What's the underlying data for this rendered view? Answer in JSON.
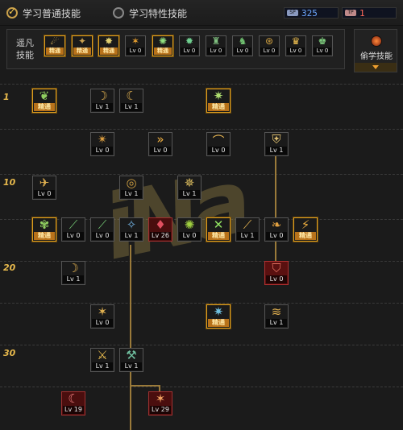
{
  "tabs": {
    "normal": "学习普通技能",
    "special": "学习特性技能"
  },
  "sp": {
    "sp_tag": "SP",
    "sp_value": "325",
    "tp_tag": "TP",
    "tp_value": "1"
  },
  "quickbar": {
    "label_line1": "遥凡",
    "label_line2": "技能"
  },
  "steal": {
    "label": "偷学技能"
  },
  "levels": [
    "1",
    "10",
    "20",
    "30"
  ],
  "colors": {
    "gold": "#e0a020",
    "accent": "#f5c84c",
    "line": "#9a7a3a"
  },
  "watermark": "iNa",
  "icons": {
    "quickbar": [
      {
        "badge": "精通",
        "mastered": true,
        "glyph": "☄",
        "color": "#e8c060"
      },
      {
        "badge": "精通",
        "mastered": true,
        "glyph": "✦",
        "color": "#c8a050"
      },
      {
        "badge": "精通",
        "mastered": true,
        "glyph": "✸",
        "color": "#e0d070"
      },
      {
        "badge": "Lv 0",
        "mastered": false,
        "glyph": "✶",
        "color": "#e8a030"
      },
      {
        "badge": "精通",
        "mastered": true,
        "glyph": "✺",
        "color": "#90e080"
      },
      {
        "badge": "Lv 0",
        "mastered": false,
        "glyph": "✹",
        "color": "#70d090"
      },
      {
        "badge": "Lv 0",
        "mastered": false,
        "glyph": "♜",
        "color": "#80c080"
      },
      {
        "badge": "Lv 0",
        "mastered": false,
        "glyph": "♞",
        "color": "#70c070"
      },
      {
        "badge": "Lv 0",
        "mastered": false,
        "glyph": "⊛",
        "color": "#d0a040"
      },
      {
        "badge": "Lv 0",
        "mastered": false,
        "glyph": "♛",
        "color": "#f0c050"
      },
      {
        "badge": "Lv 0",
        "mastered": false,
        "glyph": "♚",
        "color": "#80d080"
      }
    ],
    "tree": [
      {
        "badge": "精通",
        "mastered": true,
        "glyph": "❦",
        "color": "#90d060"
      },
      {
        "badge": "Lv 1",
        "mastered": false,
        "glyph": "☽",
        "color": "#e0b050"
      },
      {
        "badge": "Lv 1",
        "mastered": false,
        "glyph": "☾",
        "color": "#e0b050"
      },
      {
        "badge": "精通",
        "mastered": true,
        "glyph": "✷",
        "color": "#b0e070"
      },
      {
        "badge": "Lv 0",
        "mastered": false,
        "glyph": "✴",
        "color": "#e0a040"
      },
      {
        "badge": "Lv 0",
        "mastered": false,
        "glyph": "»",
        "color": "#f0b040"
      },
      {
        "badge": "Lv 0",
        "mastered": false,
        "glyph": "⌒",
        "color": "#e0b050"
      },
      {
        "badge": "Lv 1",
        "mastered": false,
        "glyph": "⛨",
        "color": "#e0c070"
      },
      {
        "badge": "Lv 0",
        "mastered": false,
        "glyph": "✈",
        "color": "#e0b050"
      },
      {
        "badge": "Lv 1",
        "mastered": false,
        "glyph": "◎",
        "color": "#d0a040"
      },
      {
        "badge": "Lv 1",
        "mastered": false,
        "glyph": "✵",
        "color": "#e0c060"
      },
      {
        "badge": "精通",
        "mastered": true,
        "glyph": "✾",
        "color": "#90d060"
      },
      {
        "badge": "Lv 0",
        "mastered": false,
        "glyph": "⟋",
        "color": "#70c070"
      },
      {
        "badge": "Lv 0",
        "mastered": false,
        "glyph": "⟋",
        "color": "#70c070"
      },
      {
        "badge": "Lv 1",
        "mastered": false,
        "glyph": "✧",
        "color": "#70b0e0"
      },
      {
        "badge": "Lv 26",
        "mastered": false,
        "glyph": "♦",
        "color": "#e05060"
      },
      {
        "badge": "Lv 0",
        "mastered": false,
        "glyph": "✺",
        "color": "#a0d040"
      },
      {
        "badge": "精通",
        "mastered": true,
        "glyph": "✕",
        "color": "#90e060"
      },
      {
        "badge": "Lv 1",
        "mastered": false,
        "glyph": "⟋",
        "color": "#e0b050"
      },
      {
        "badge": "Lv 0",
        "mastered": false,
        "glyph": "❧",
        "color": "#e0a040"
      },
      {
        "badge": "精通",
        "mastered": true,
        "glyph": "⚡",
        "color": "#f0b040"
      },
      {
        "badge": "Lv 1",
        "mastered": false,
        "glyph": "☽",
        "color": "#e0b050"
      },
      {
        "badge": "Lv 0",
        "mastered": false,
        "glyph": "⛉",
        "color": "#e07060"
      },
      {
        "badge": "Lv 0",
        "mastered": false,
        "glyph": "✶",
        "color": "#e0b050"
      },
      {
        "badge": "精通",
        "mastered": true,
        "glyph": "✷",
        "color": "#70c0e0"
      },
      {
        "badge": "Lv 1",
        "mastered": false,
        "glyph": "≋",
        "color": "#e0b050"
      },
      {
        "badge": "Lv 1",
        "mastered": false,
        "glyph": "⚔",
        "color": "#f0c050"
      },
      {
        "badge": "Lv 1",
        "mastered": false,
        "glyph": "⚒",
        "color": "#70c0a0"
      },
      {
        "badge": "Lv 19",
        "mastered": false,
        "glyph": "☾",
        "color": "#f08080"
      },
      {
        "badge": "Lv 29",
        "mastered": false,
        "glyph": "✶",
        "color": "#f0a060"
      }
    ]
  }
}
